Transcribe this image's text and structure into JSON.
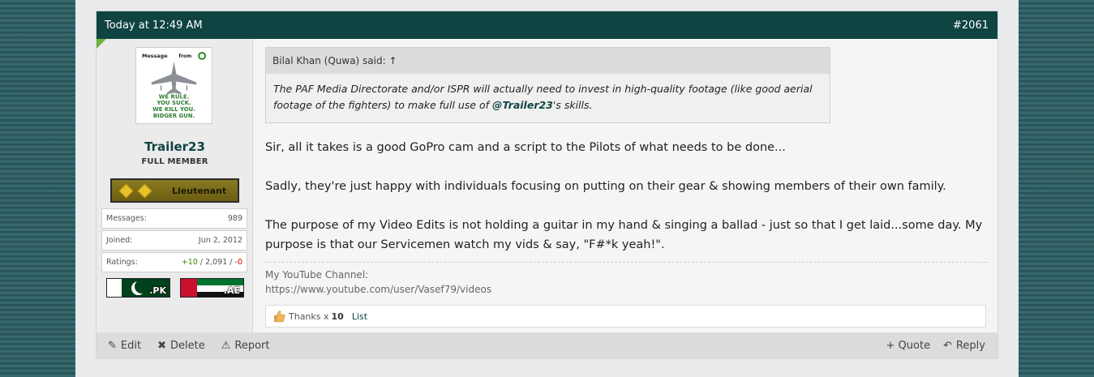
{
  "post": {
    "timestamp": "Today at 12:49 AM",
    "number": "#2061"
  },
  "user": {
    "avatar_text": {
      "line1": "Message",
      "line2": "from",
      "slogan1": "WE RULE.",
      "slogan2": "YOU SUCK.",
      "slogan3": "WE KILL YOU.",
      "slogan4": "BIDGER GUN."
    },
    "name": "Trailer23",
    "title": "FULL MEMBER",
    "rank": "Lieutenant",
    "stats": [
      {
        "label": "Messages:",
        "value": "989"
      },
      {
        "label": "Joined:",
        "value": "Jun 2, 2012"
      }
    ],
    "ratings": {
      "label": "Ratings:",
      "positive": "+10",
      "sep1": " / ",
      "neutral": "2,091",
      "sep2": " / ",
      "negative": "-0"
    },
    "flags": [
      ".PK",
      ".AE"
    ]
  },
  "quote": {
    "author": "Bilal Khan (Quwa) said:",
    "arrow": "↑",
    "text_before": "The PAF Media Directorate and/or ISPR will actually need to invest in high-quality footage (like good aerial footage of the fighters) to make full use of ",
    "mention": "@Trailer23",
    "text_after": "'s skills."
  },
  "message": [
    "Sir, all it takes is a good GoPro cam and a script to the Pilots of what needs to be done...",
    "Sadly, they're just happy with individuals focusing on putting on their gear & showing members of their own family.",
    "The purpose of my Video Edits is not holding a guitar in my hand & singing a ballad - just so that I get laid...some day. My purpose is that our Servicemen watch my vids & say, \"F#*k yeah!\"."
  ],
  "signature": {
    "line1": "My YouTube Channel:",
    "line2": "https://www.youtube.com/user/Vasef79/videos"
  },
  "likes": {
    "label": "Thanks x",
    "count": "10",
    "list": "List"
  },
  "footer": {
    "edit": "Edit",
    "delete": "Delete",
    "report": "Report",
    "quote": "+ Quote",
    "reply": "Reply"
  },
  "colors": {
    "header": "#0f4443",
    "accent": "#6cb33f"
  }
}
